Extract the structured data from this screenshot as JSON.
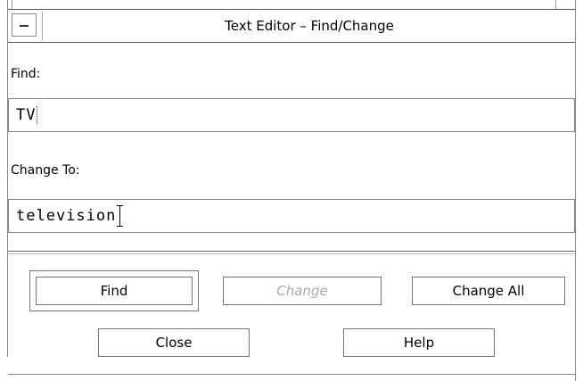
{
  "window": {
    "title": "Text Editor – Find/Change",
    "menu_icon": "window-menu-icon"
  },
  "find": {
    "label": "Find:",
    "value": "TV"
  },
  "change_to": {
    "label": "Change To:",
    "value": "television"
  },
  "buttons": {
    "find": "Find",
    "change": "Change",
    "change_all": "Change All",
    "close": "Close",
    "help": "Help"
  },
  "states": {
    "change_enabled": false,
    "default_button": "find"
  }
}
